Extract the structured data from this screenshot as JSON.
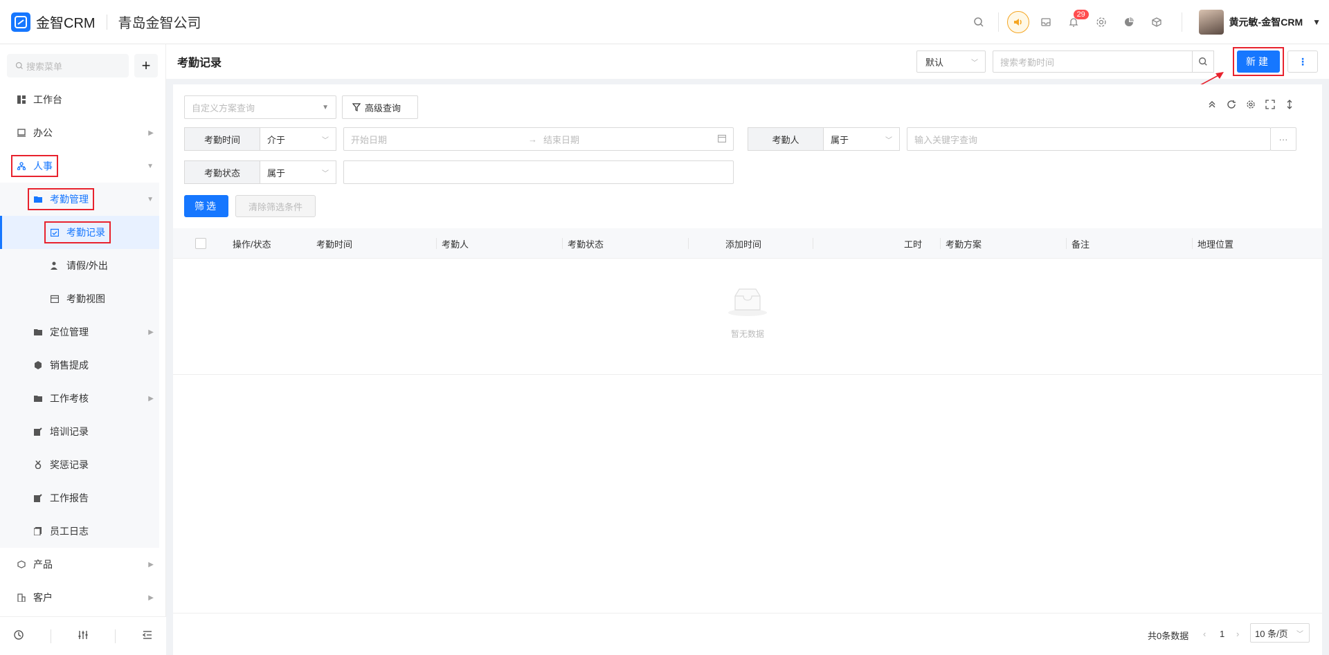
{
  "app": {
    "logo_text": "金智CRM",
    "company": "青岛金智公司",
    "notifications_count": "29",
    "user_name": "黄元敏-金智CRM"
  },
  "sidebar": {
    "search_placeholder": "搜索菜单",
    "items": [
      {
        "label": "工作台",
        "icon": "dashboard-icon"
      },
      {
        "label": "办公",
        "icon": "office-icon"
      },
      {
        "label": "人事",
        "icon": "org-icon"
      },
      {
        "label": "考勤管理",
        "icon": "folder-icon"
      },
      {
        "label": "考勤记录",
        "icon": "calendar-check-icon"
      },
      {
        "label": "请假/外出",
        "icon": "person-icon"
      },
      {
        "label": "考勤视图",
        "icon": "calendar-icon"
      },
      {
        "label": "定位管理",
        "icon": "folder-icon"
      },
      {
        "label": "销售提成",
        "icon": "hexagon-icon"
      },
      {
        "label": "工作考核",
        "icon": "folder-icon"
      },
      {
        "label": "培训记录",
        "icon": "edit-icon"
      },
      {
        "label": "奖惩记录",
        "icon": "medal-icon"
      },
      {
        "label": "工作报告",
        "icon": "edit-icon"
      },
      {
        "label": "员工日志",
        "icon": "copy-icon"
      },
      {
        "label": "产品",
        "icon": "box-icon"
      },
      {
        "label": "客户",
        "icon": "building-icon"
      }
    ]
  },
  "header": {
    "title": "考勤记录",
    "view_select": "默认",
    "search_placeholder": "搜索考勤时间",
    "new_label": "新建"
  },
  "filters": {
    "custom_query_placeholder": "自定义方案查询",
    "advanced_query": "高级查询",
    "time_label": "考勤时间",
    "time_op": "介于",
    "start_placeholder": "开始日期",
    "end_placeholder": "结束日期",
    "person_label": "考勤人",
    "person_op": "属于",
    "person_placeholder": "输入关键字查询",
    "status_label": "考勤状态",
    "status_op": "属于",
    "filter_btn": "筛选",
    "clear_btn": "清除筛选条件"
  },
  "table": {
    "columns": [
      "操作/状态",
      "考勤时间",
      "考勤人",
      "考勤状态",
      "添加时间",
      "工时",
      "考勤方案",
      "备注",
      "地理位置"
    ],
    "empty_text": "暂无数据"
  },
  "pagination": {
    "total": "共0条数据",
    "page": "1",
    "page_size": "10 条/页"
  },
  "colors": {
    "primary": "#1677ff",
    "highlight": "#e8222d"
  }
}
